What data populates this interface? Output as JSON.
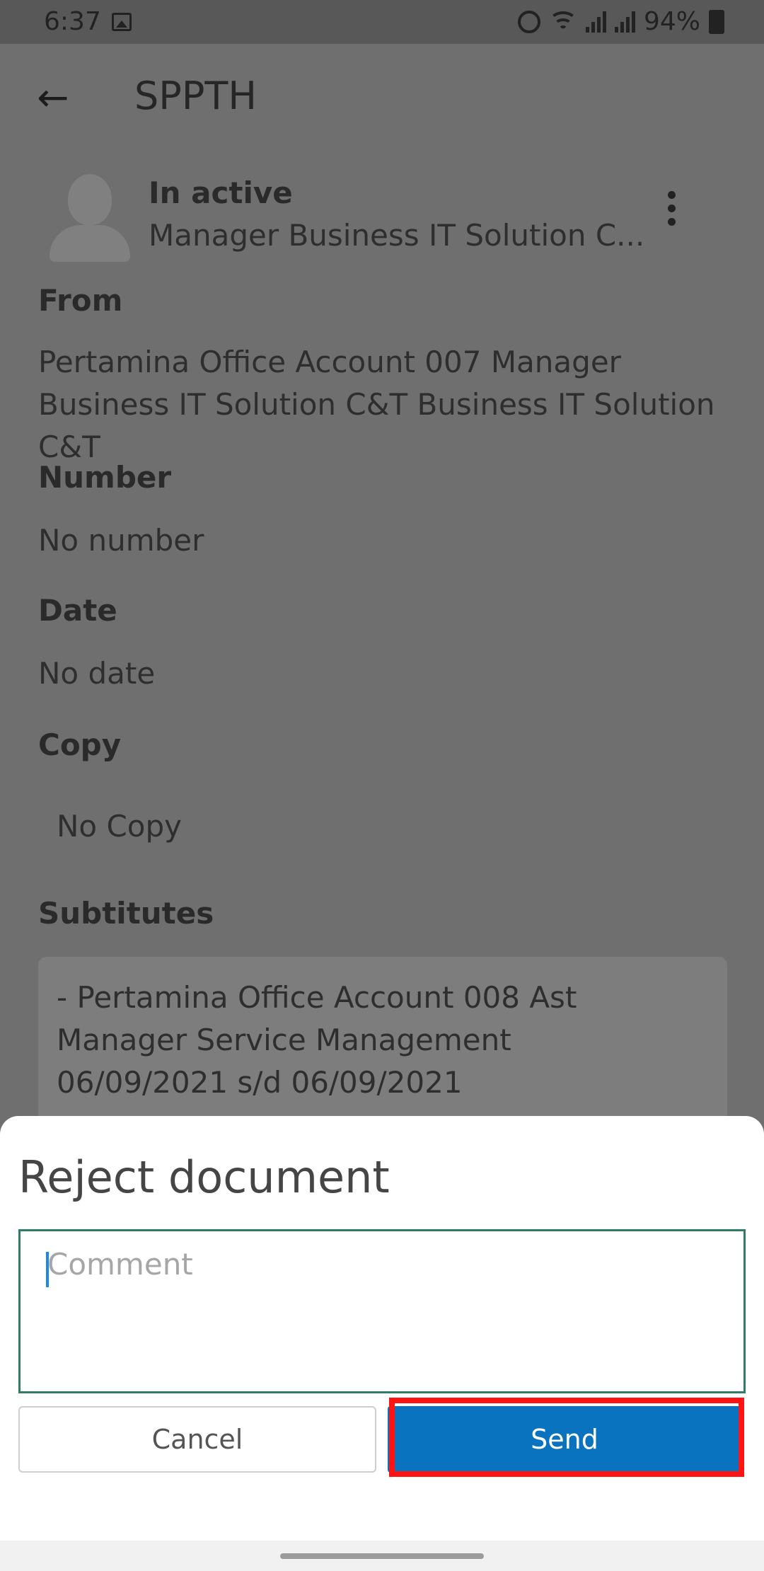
{
  "status_bar": {
    "time": "6:37",
    "battery": "94%",
    "icons": [
      "image-icon",
      "alarm-icon",
      "wifi-icon",
      "signal-icon",
      "signal-icon",
      "battery-charging-icon"
    ]
  },
  "app_bar": {
    "title": "SPPTH",
    "back_icon": "arrow-left-icon"
  },
  "profile": {
    "status": "In active",
    "role": "Manager Business IT Solution C...",
    "more_icon": "more-vertical-icon"
  },
  "details": {
    "from_label": "From",
    "from_value": "Pertamina Office Account 007 Manager Business IT Solution C&T Business IT Solution C&T",
    "number_label": "Number",
    "number_value": "No number",
    "date_label": "Date",
    "date_value": "No date",
    "copy_label": "Copy",
    "copy_value": "No Copy",
    "substitutes_label": "Subtitutes",
    "substitutes_value": "- Pertamina Office Account 008 Ast Manager Service Management\n 06/09/2021 s/d 06/09/2021"
  },
  "reject_dialog": {
    "title": "Reject document",
    "comment_placeholder": "Comment",
    "comment_value": "",
    "cancel_label": "Cancel",
    "send_label": "Send"
  },
  "colors": {
    "send_button": "#0a73bf",
    "input_border": "#2f7d62",
    "highlight": "#ff1414",
    "scrim": "#6f6f6f"
  }
}
